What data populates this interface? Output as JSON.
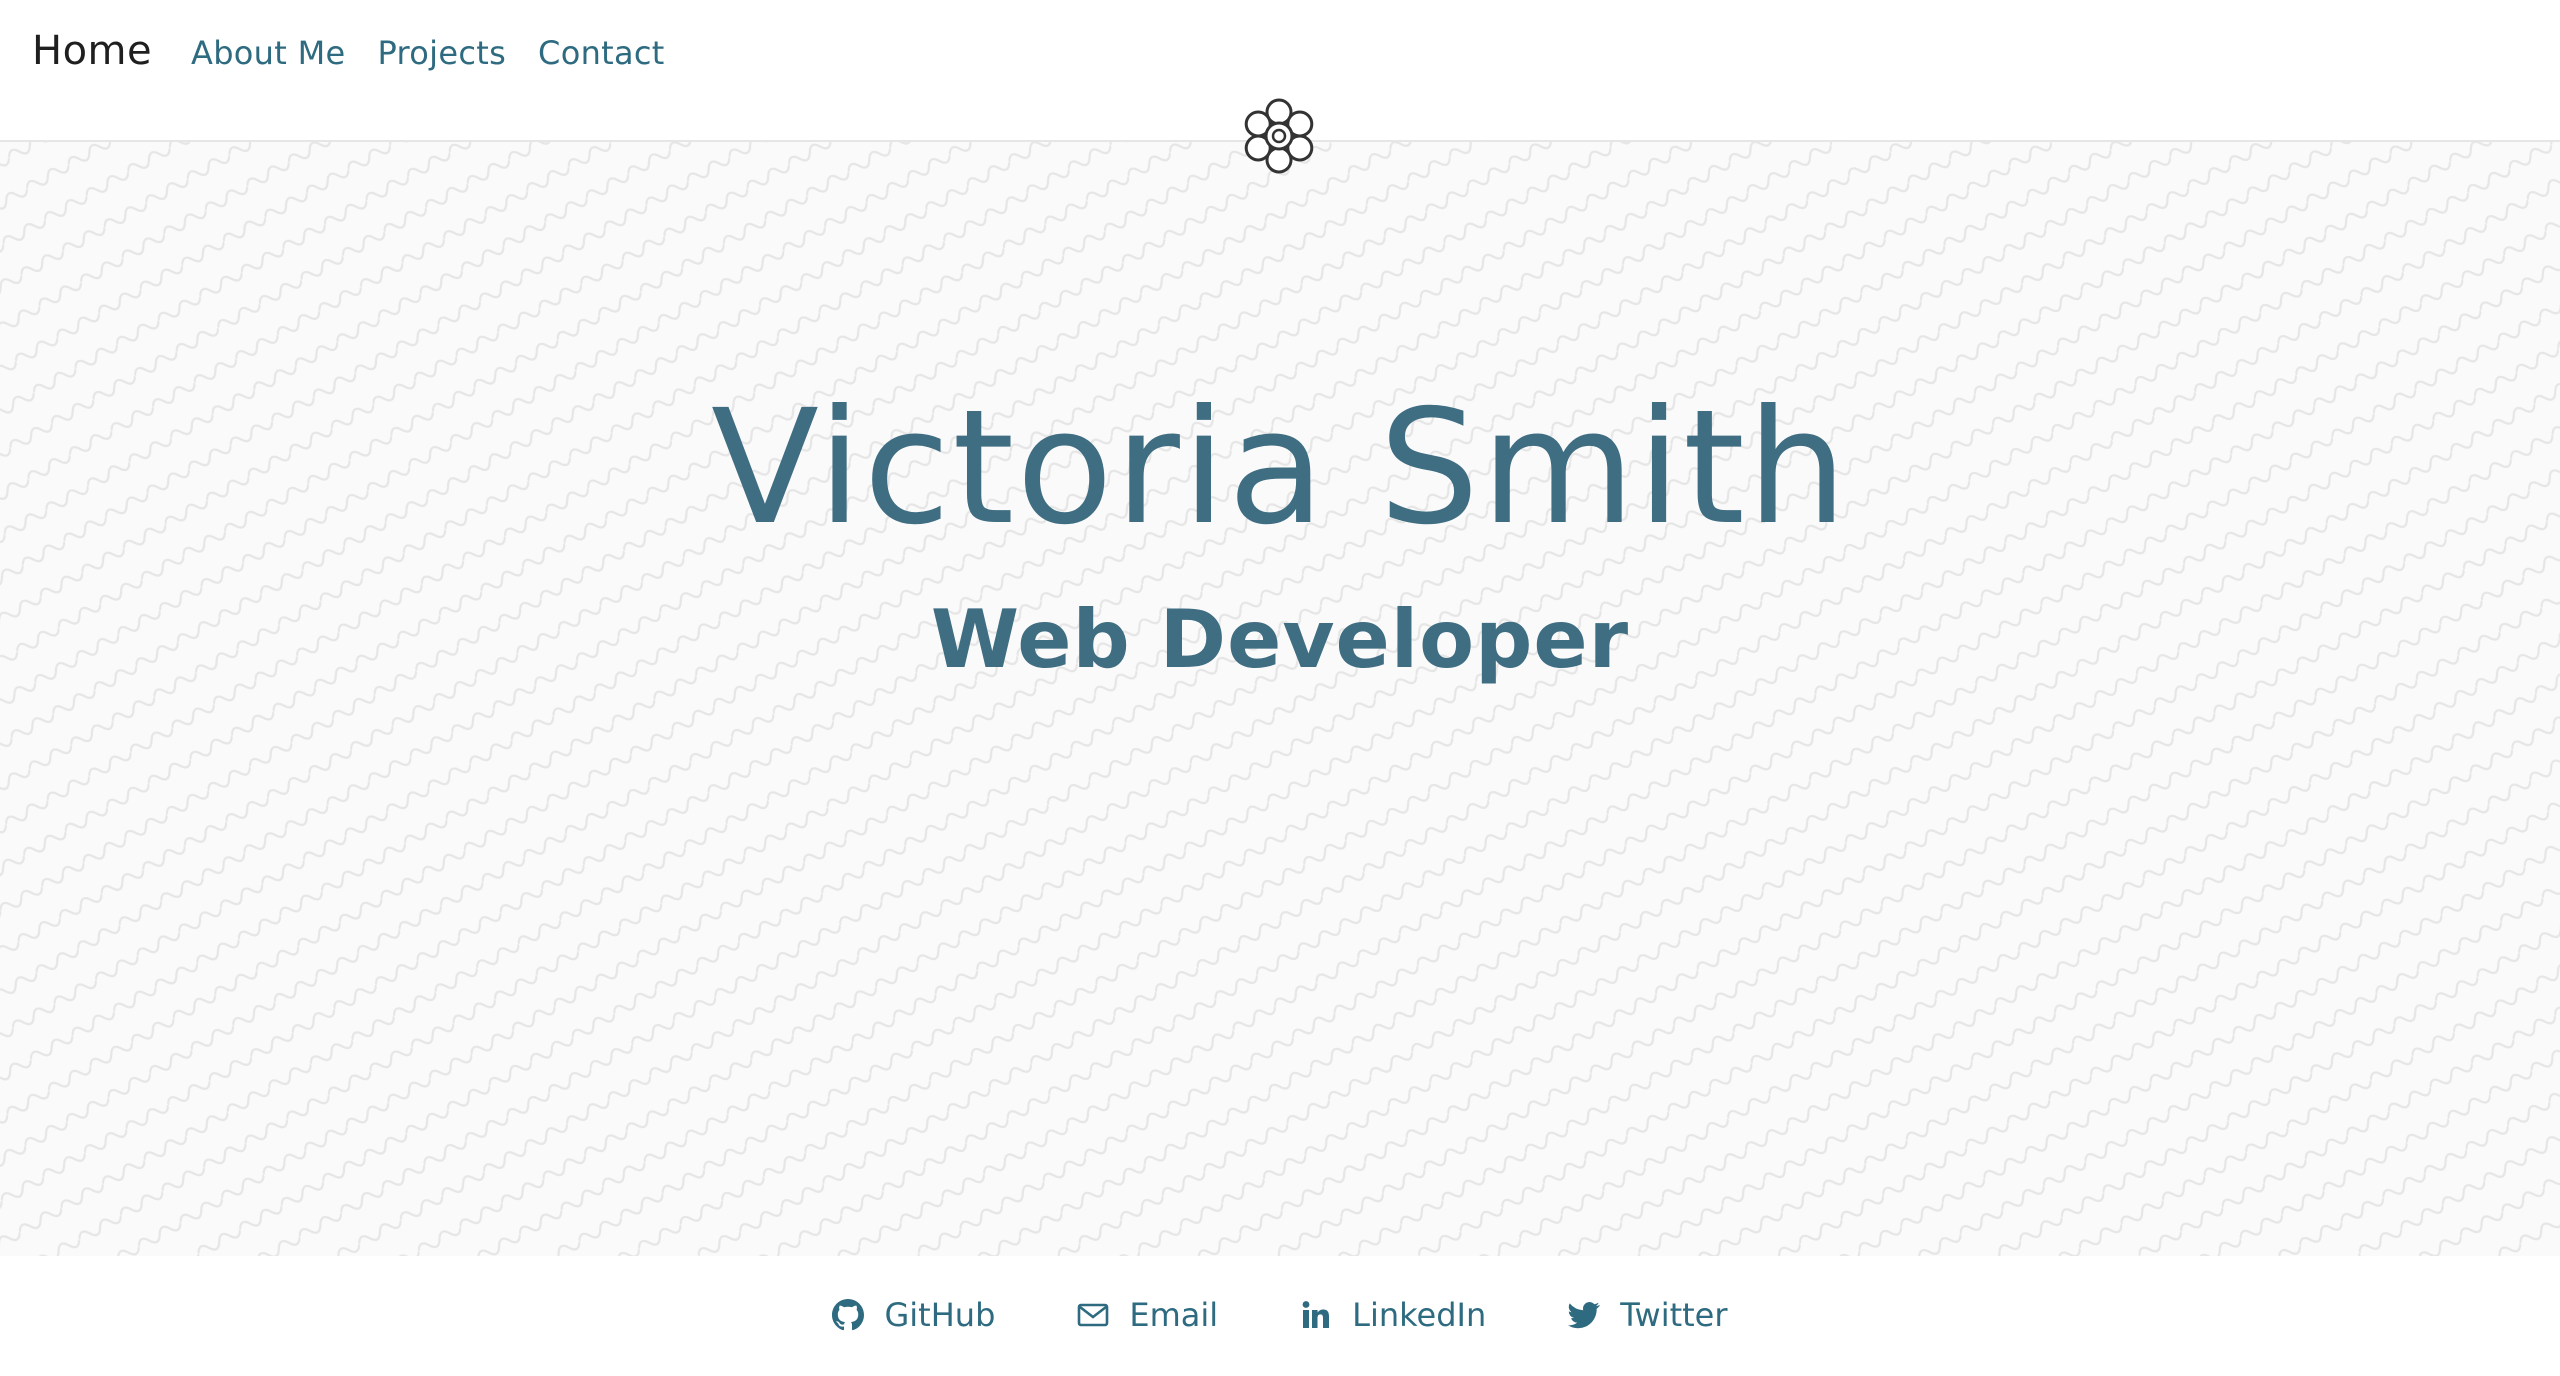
{
  "nav": {
    "brand": "Home",
    "links": [
      {
        "label": "About Me"
      },
      {
        "label": "Projects"
      },
      {
        "label": "Contact"
      }
    ]
  },
  "logo_icon": "flower-icon",
  "hero": {
    "name": "Victoria Smith",
    "title": "Web Developer"
  },
  "footer": {
    "links": [
      {
        "label": "GitHub",
        "icon": "github-icon"
      },
      {
        "label": "Email",
        "icon": "envelope-icon"
      },
      {
        "label": "LinkedIn",
        "icon": "linkedin-icon"
      },
      {
        "label": "Twitter",
        "icon": "twitter-icon"
      }
    ]
  },
  "colors": {
    "accent": "#2e6b80",
    "hero_text": "#3f6d82",
    "brand_text": "#1f1f1f",
    "hero_background": "#fafafa"
  }
}
